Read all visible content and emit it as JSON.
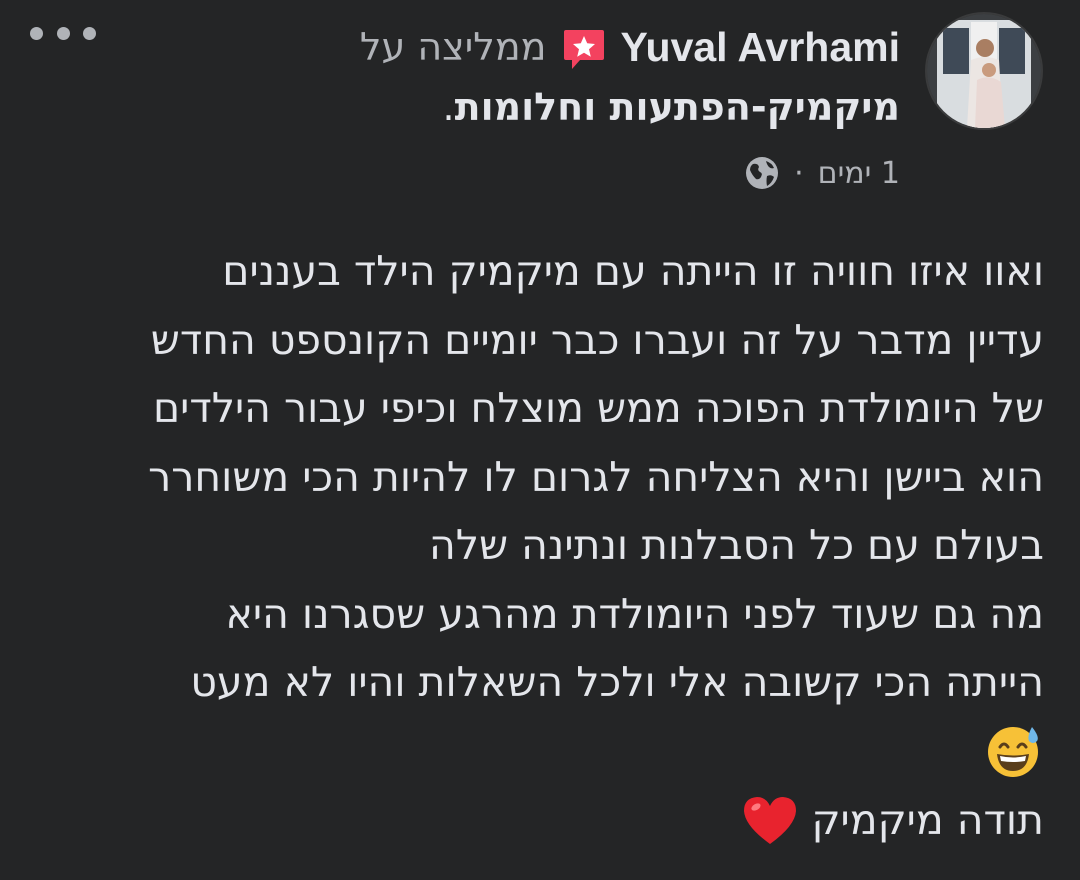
{
  "post": {
    "author": "Yuval Avrhami",
    "recommends_text": "ממליצה על",
    "page_name": "מיקמיק-הפתעות וחלומות",
    "page_suffix": ".",
    "time": "1 ימים",
    "separator": "·",
    "privacy_icon": "globe-icon",
    "more_icon": "more-options-icon",
    "recommend_icon": "recommend-star-icon",
    "accent_color": "#f3425f"
  },
  "body": {
    "lines": [
      "ואוו איזו חוויה זו הייתה עם מיקמיק הילד בעננים",
      "עדיין מדבר על זה ועברו כבר יומיים הקונספט החדש",
      "של היומולדת הפוכה ממש מוצלח וכיפי עבור הילדים",
      "הוא ביישן והיא הצליחה לגרום לו להיות הכי משוחרר",
      "בעולם עם כל הסבלנות ונתינה שלה",
      "מה גם שעוד לפני היומולדת מהרגע שסגרנו  היא",
      "הייתה הכי קשובה אלי ולכל השאלות והיו לא מעט"
    ],
    "emoji": "grinning-sweat-emoji",
    "thanks": "תודה מיקמיק",
    "heart": "red-heart-emoji"
  }
}
